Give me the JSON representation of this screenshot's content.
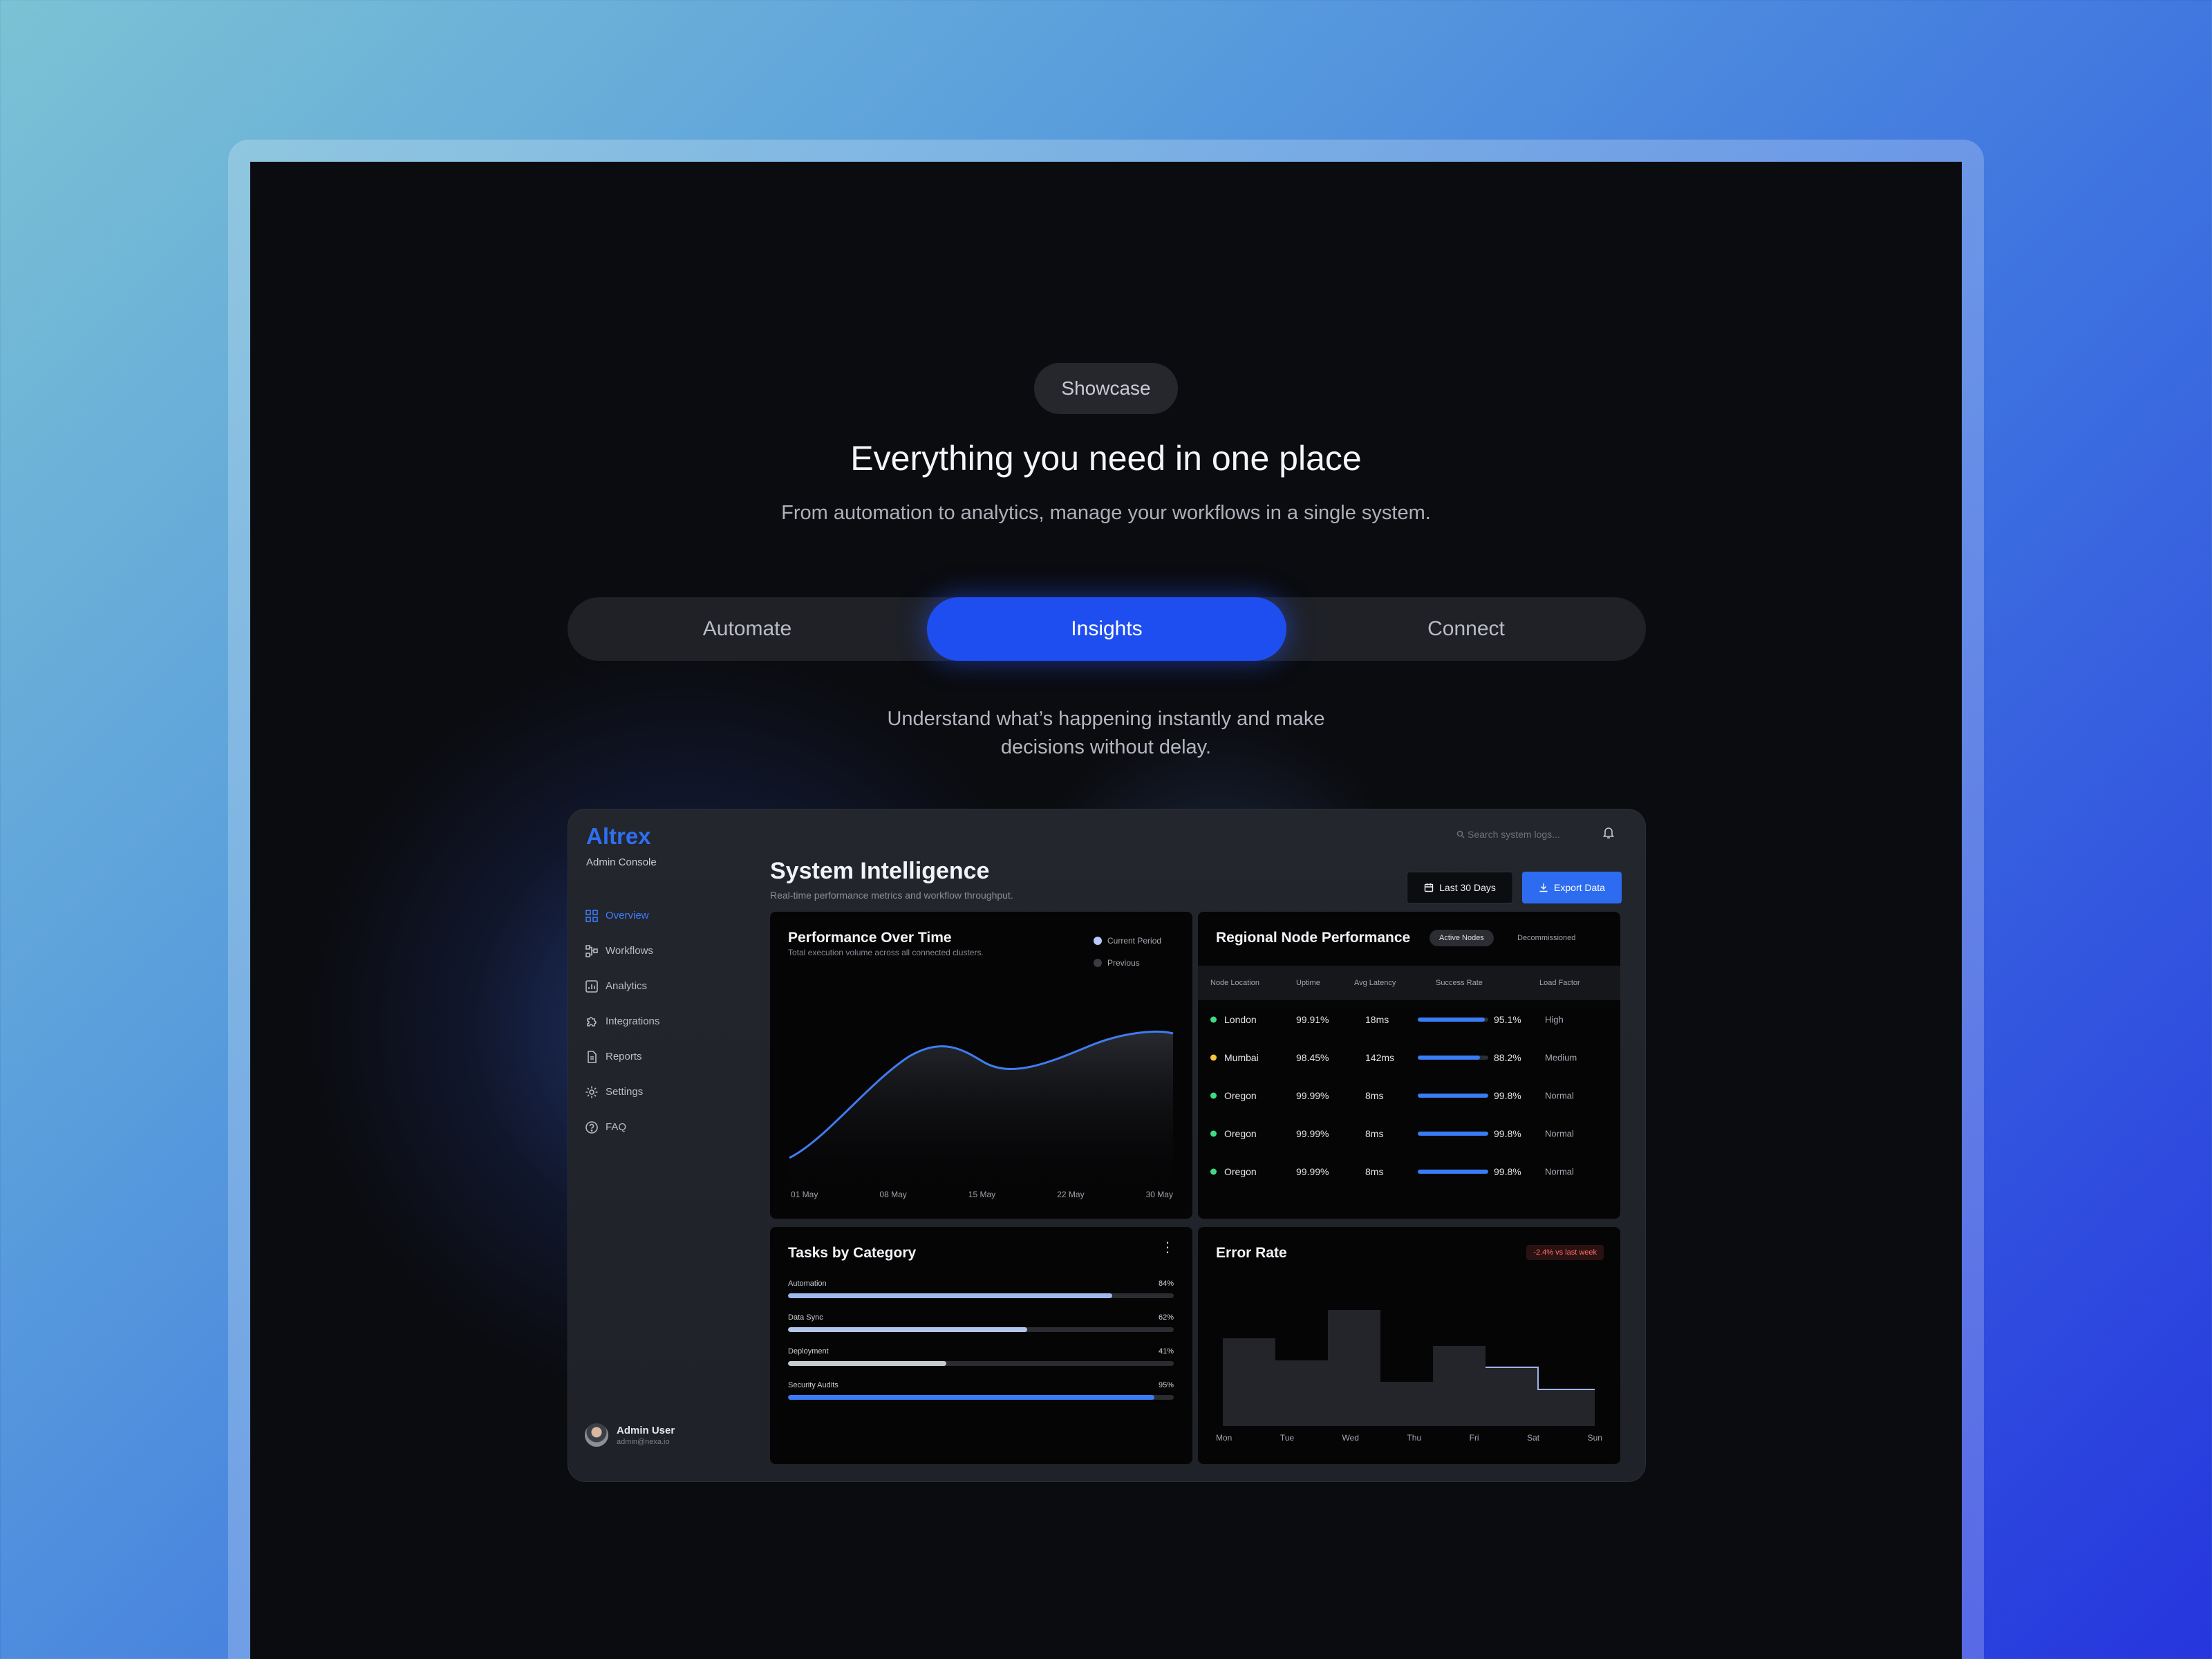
{
  "showcase": {
    "pill": "Showcase",
    "headline": "Everything you need in one place",
    "subheadline": "From automation to analytics, manage your workflows in a single system.",
    "tabs": [
      {
        "label": "Automate",
        "active": false
      },
      {
        "label": "Insights",
        "active": true
      },
      {
        "label": "Connect",
        "active": false
      }
    ],
    "description_line1": "Understand what’s happening instantly and make",
    "description_line2": "decisions without delay."
  },
  "dashboard": {
    "brand": "Altrex",
    "brand_sub": "Admin Console",
    "nav": [
      {
        "label": "Overview",
        "icon": "grid-icon",
        "active": true
      },
      {
        "label": "Workflows",
        "icon": "workflow-icon",
        "active": false
      },
      {
        "label": "Analytics",
        "icon": "chart-icon",
        "active": false
      },
      {
        "label": "Integrations",
        "icon": "puzzle-icon",
        "active": false
      },
      {
        "label": "Reports",
        "icon": "document-icon",
        "active": false
      },
      {
        "label": "Settings",
        "icon": "gear-icon",
        "active": false
      },
      {
        "label": "FAQ",
        "icon": "help-icon",
        "active": false
      }
    ],
    "user": {
      "name": "Admin User",
      "email": "admin@nexa.io"
    },
    "search_placeholder": "Search system logs...",
    "title": "System Intelligence",
    "subtitle": "Real-time performance metrics and workflow throughput.",
    "range_button": "Last 30 Days",
    "export_button": "Export Data",
    "performance": {
      "title": "Performance Over Time",
      "subtitle": "Total execution volume across all connected clusters.",
      "legend": [
        {
          "label": "Current Period",
          "color": "#b8c9ff"
        },
        {
          "label": "Previous",
          "color": "#3a3c42"
        }
      ],
      "x_labels": [
        "01 May",
        "08 May",
        "15 May",
        "22 May",
        "30 May"
      ]
    },
    "regional": {
      "title": "Regional Node Performance",
      "chip_active": "Active Nodes",
      "chip_inactive": "Decommissioned",
      "columns": [
        "Node Location",
        "Uptime",
        "Avg Latency",
        "Success Rate",
        "Load Factor"
      ],
      "rows": [
        {
          "location": "London",
          "status_color": "#3ddc84",
          "uptime": "99.91%",
          "latency": "18ms",
          "success": "95.1%",
          "success_value": 95.1,
          "load": "High"
        },
        {
          "location": "Mumbai",
          "status_color": "#f5c542",
          "uptime": "98.45%",
          "latency": "142ms",
          "success": "88.2%",
          "success_value": 88.2,
          "load": "Medium"
        },
        {
          "location": "Oregon",
          "status_color": "#3ddc84",
          "uptime": "99.99%",
          "latency": "8ms",
          "success": "99.8%",
          "success_value": 99.8,
          "load": "Normal"
        },
        {
          "location": "Oregon",
          "status_color": "#3ddc84",
          "uptime": "99.99%",
          "latency": "8ms",
          "success": "99.8%",
          "success_value": 99.8,
          "load": "Normal"
        },
        {
          "location": "Oregon",
          "status_color": "#3ddc84",
          "uptime": "99.99%",
          "latency": "8ms",
          "success": "99.8%",
          "success_value": 99.8,
          "load": "Normal"
        }
      ]
    },
    "tasks": {
      "title": "Tasks by Category",
      "items": [
        {
          "label": "Automation",
          "percent": "84%",
          "value": 84,
          "color": "#9fb9f0"
        },
        {
          "label": "Data Sync",
          "percent": "62%",
          "value": 62,
          "color": "#b3c6ea"
        },
        {
          "label": "Deployment",
          "percent": "41%",
          "value": 41,
          "color": "#c7cad1"
        },
        {
          "label": "Security Audits",
          "percent": "95%",
          "value": 95,
          "color": "#3a7cf5"
        }
      ]
    },
    "error_rate": {
      "title": "Error Rate",
      "badge": "-2.4% vs last week",
      "days": [
        "Mon",
        "Tue",
        "Wed",
        "Thu",
        "Fri",
        "Sat",
        "Sun"
      ]
    }
  }
}
